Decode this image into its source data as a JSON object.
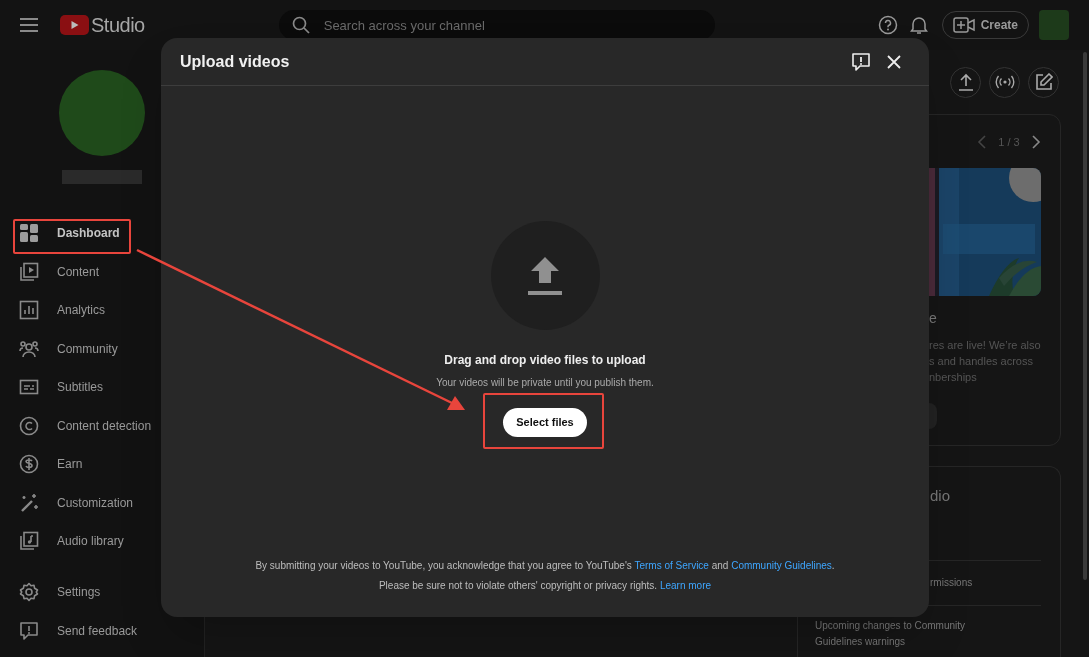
{
  "header": {
    "logo_text": "Studio",
    "search": {
      "placeholder": "Search across your channel"
    },
    "create_button": "Create"
  },
  "sidebar": {
    "items": [
      {
        "label": "Dashboard",
        "selected": true
      },
      {
        "label": "Content",
        "selected": false
      },
      {
        "label": "Analytics",
        "selected": false
      },
      {
        "label": "Community",
        "selected": false
      },
      {
        "label": "Subtitles",
        "selected": false
      },
      {
        "label": "Content detection",
        "selected": false
      },
      {
        "label": "Earn",
        "selected": false
      },
      {
        "label": "Customization",
        "selected": false
      },
      {
        "label": "Audio library",
        "selected": false
      }
    ],
    "footer_items": [
      {
        "label": "Settings"
      },
      {
        "label": "Send feedback"
      }
    ]
  },
  "cards": [
    {
      "pager": "1 / 3",
      "title": "e",
      "lines": [
        "res are live! We’re also",
        "s and handles across",
        "nberships"
      ]
    },
    {
      "title": "dio",
      "items": [
        "rmissions",
        "Upcoming changes to Community Guidelines warnings"
      ]
    }
  ],
  "modal": {
    "title": "Upload videos",
    "heading": "Drag and drop video files to upload",
    "subtext": "Your videos will be private until you publish them.",
    "button": "Select files",
    "legal": [
      [
        {
          "kind": "text",
          "text": "By submitting your videos to YouTube, you acknowledge that you agree to YouTube's "
        },
        {
          "kind": "link",
          "text": "Terms of Service"
        },
        {
          "kind": "text",
          "text": " and "
        },
        {
          "kind": "link",
          "text": "Community Guidelines"
        },
        {
          "kind": "text",
          "text": "."
        }
      ],
      [
        {
          "kind": "text",
          "text": "Please be sure not to violate others' copyright or privacy rights. "
        },
        {
          "kind": "link",
          "text": "Learn more"
        }
      ]
    ]
  }
}
